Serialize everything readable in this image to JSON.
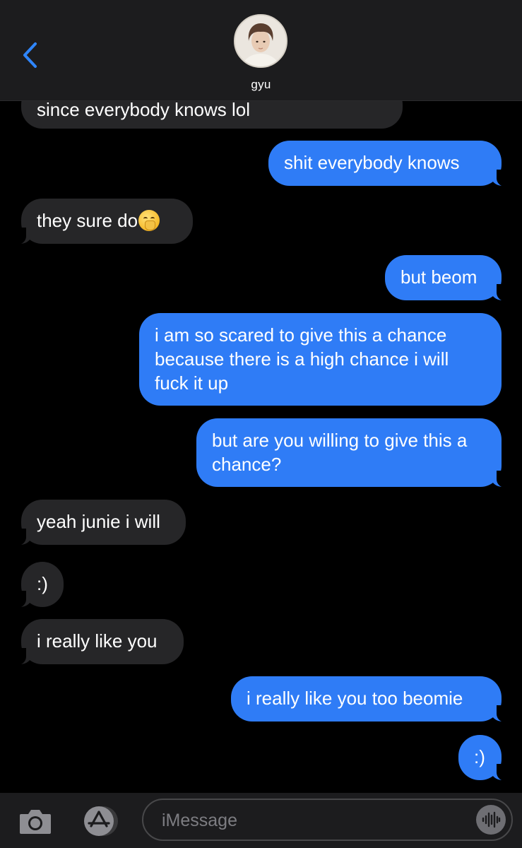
{
  "header": {
    "contact_name": "gyu"
  },
  "messages": [
    {
      "side": "in",
      "text": "since everybody knows lol"
    },
    {
      "side": "out",
      "text": "shit everybody knows"
    },
    {
      "side": "in",
      "text": "they sure do",
      "emoji": "hand-over-mouth-emoji"
    },
    {
      "side": "out",
      "text": "but beom"
    },
    {
      "side": "out",
      "text": "i am so scared to give this a chance because there is a high chance i will fuck it up"
    },
    {
      "side": "out",
      "text": "but are you willing to give this a chance?"
    },
    {
      "side": "in",
      "text": "yeah junie i will"
    },
    {
      "side": "in",
      "text": ":)"
    },
    {
      "side": "in",
      "text": "i really like you"
    },
    {
      "side": "out",
      "text": "i really like you too beomie"
    },
    {
      "side": "out",
      "text": ":)"
    }
  ],
  "composer": {
    "placeholder": "iMessage",
    "value": ""
  },
  "icons": {
    "back": "chevron-left-icon",
    "camera": "camera-icon",
    "apps": "app-store-icon",
    "audio": "audio-waveform-icon"
  },
  "colors": {
    "outgoing_bubble": "#2f7cf6",
    "incoming_bubble": "#262628",
    "accent": "#2f86ff"
  }
}
